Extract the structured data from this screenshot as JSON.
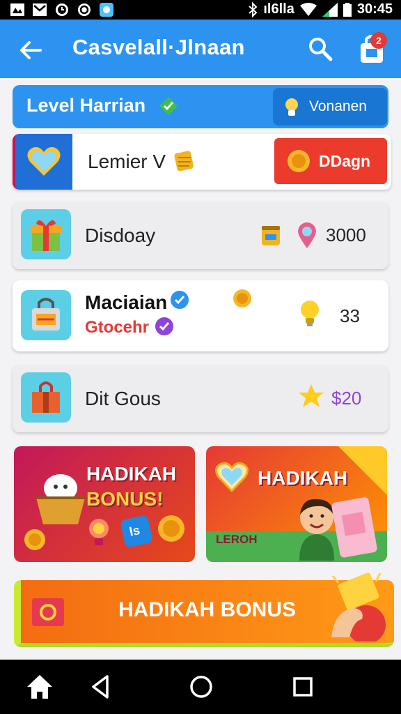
{
  "status_bar": {
    "time": "30:45",
    "signal_text": "ıl6lla"
  },
  "app_bar": {
    "title": "Casvelall·Jlnaan",
    "cart_badge": "2"
  },
  "level_bar": {
    "label": "Level Harrian",
    "button_label": "Vonanen"
  },
  "cards": [
    {
      "label": "Lemier V",
      "action_label": "DDagn"
    },
    {
      "label": "Disdoay",
      "value": "3000"
    },
    {
      "label": "Maciaian",
      "sublabel": "Gtocehr",
      "value": "33"
    },
    {
      "label": "Dit Gous",
      "value": "$20"
    }
  ],
  "promos": [
    {
      "title_line1": "HADIKAH",
      "title_line2": "BONUS!",
      "chip_text": "ls"
    },
    {
      "title": "HADIKAH",
      "badge": "LEROH"
    }
  ],
  "bottom_banner": {
    "title": "HADIKAH BONUS"
  },
  "colors": {
    "primary": "#2c93f0",
    "accent_red": "#ea3b2c",
    "gold": "#f4b624",
    "purple": "#8e44d8"
  },
  "icons": [
    "back-icon",
    "search-icon",
    "cart-icon",
    "heart-icon",
    "gift-icon",
    "coin-icon",
    "bulb-icon",
    "star-icon",
    "home-icon"
  ]
}
